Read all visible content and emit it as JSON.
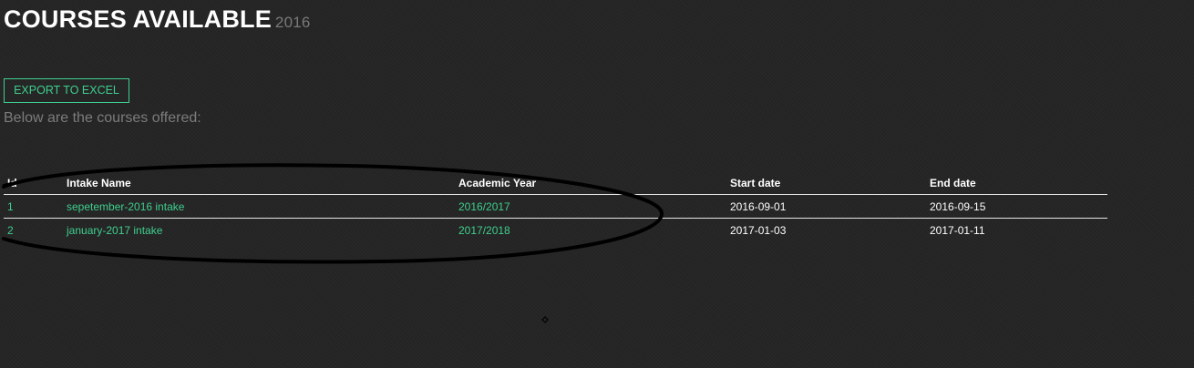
{
  "header": {
    "title": "COURSES AVAILABLE",
    "year": "2016"
  },
  "toolbar": {
    "export_label": "EXPORT TO EXCEL"
  },
  "intro": "Below are the courses offered:",
  "table": {
    "columns": [
      "Id",
      "Intake Name",
      "Academic Year",
      "Start date",
      "End date"
    ],
    "rows": [
      {
        "id": "1",
        "intake_name": "sepetember-2016 intake",
        "academic_year": "2016/2017",
        "start_date": "2016-09-01",
        "end_date": "2016-09-15"
      },
      {
        "id": "2",
        "intake_name": "january-2017 intake",
        "academic_year": "2017/2018",
        "start_date": "2017-01-03",
        "end_date": "2017-01-11"
      }
    ]
  },
  "colors": {
    "accent": "#3ecf8e",
    "background": "#262626",
    "muted_text": "#7c7c7c",
    "annotation": "#000000"
  }
}
